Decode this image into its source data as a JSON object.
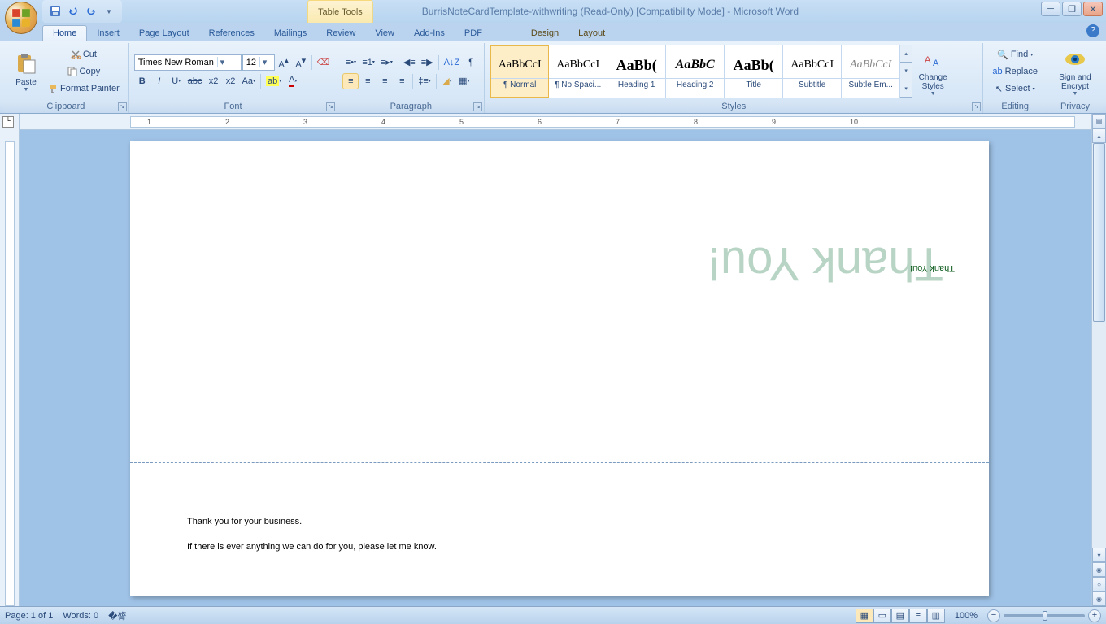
{
  "title": {
    "table_tools": "Table Tools",
    "doc": "BurrisNoteCardTemplate-withwriting (Read-Only) [Compatibility Mode] - Microsoft Word"
  },
  "tabs": {
    "home": "Home",
    "insert": "Insert",
    "page_layout": "Page Layout",
    "references": "References",
    "mailings": "Mailings",
    "review": "Review",
    "view": "View",
    "addins": "Add-Ins",
    "pdf": "PDF",
    "design": "Design",
    "layout": "Layout"
  },
  "clipboard": {
    "paste": "Paste",
    "cut": "Cut",
    "copy": "Copy",
    "format_painter": "Format Painter",
    "label": "Clipboard"
  },
  "font": {
    "name": "Times New Roman",
    "size": "12",
    "label": "Font"
  },
  "paragraph": {
    "label": "Paragraph"
  },
  "styles": {
    "label": "Styles",
    "items": [
      {
        "preview": "AaBbCcI",
        "name": "¶ Normal"
      },
      {
        "preview": "AaBbCcI",
        "name": "¶ No Spaci..."
      },
      {
        "preview": "AaBb(",
        "name": "Heading 1"
      },
      {
        "preview": "AaBbC",
        "name": "Heading 2"
      },
      {
        "preview": "AaBb(",
        "name": "Title"
      },
      {
        "preview": "AaBbCcI",
        "name": "Subtitle"
      },
      {
        "preview": "AaBbCcI",
        "name": "Subtle Em..."
      }
    ],
    "change": "Change Styles"
  },
  "editing": {
    "find": "Find",
    "replace": "Replace",
    "select": "Select",
    "label": "Editing"
  },
  "privacy": {
    "sign": "Sign and Encrypt",
    "label": "Privacy"
  },
  "document": {
    "thank_you_shadow": "Thank You!",
    "thank_you": "Thank You!",
    "p1": "Thank you for your business.",
    "p2": "If there is ever anything we can do for you, please let me know."
  },
  "status": {
    "page": "Page: 1 of 1",
    "words": "Words: 0",
    "zoom": "100%"
  },
  "ruler_numbers": [
    "1",
    "2",
    "3",
    "4",
    "5",
    "6",
    "7",
    "8",
    "9",
    "10"
  ]
}
